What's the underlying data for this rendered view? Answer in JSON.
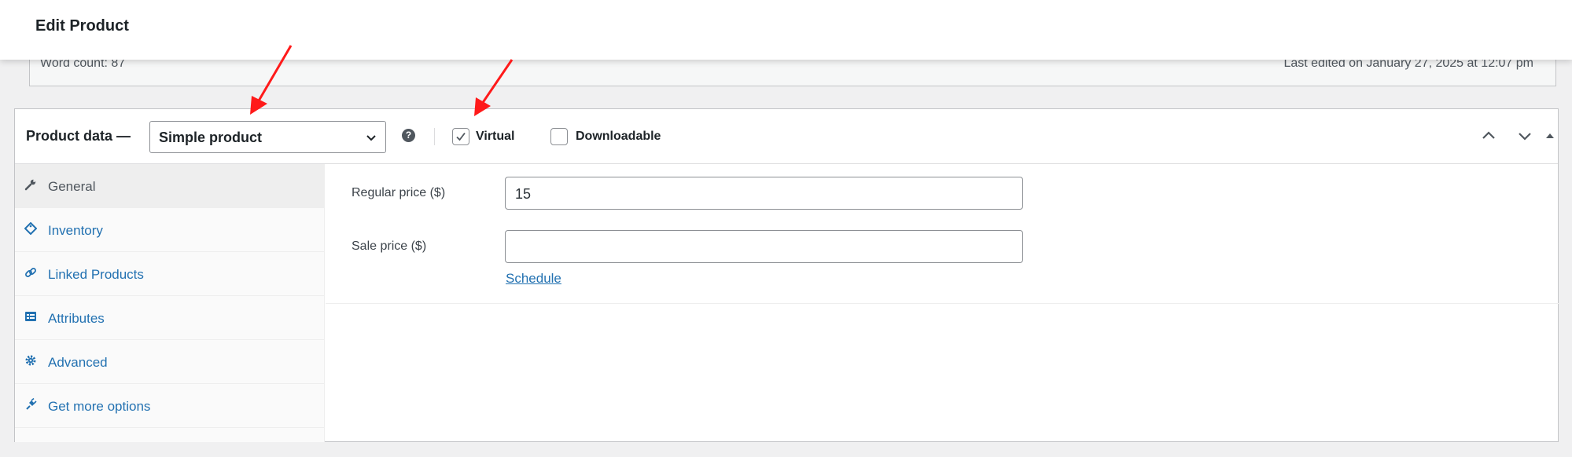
{
  "header": {
    "title": "Edit Product"
  },
  "editor_status": {
    "word_count": "Word count: 87",
    "last_edited": "Last edited on January 27, 2025 at 12:07 pm"
  },
  "product_data": {
    "title": "Product data —",
    "type_select": {
      "selected": "Simple product"
    },
    "help_icon": "?",
    "virtual": {
      "label": "Virtual",
      "checked": true
    },
    "downloadable": {
      "label": "Downloadable",
      "checked": false
    }
  },
  "tabs": [
    {
      "label": "General",
      "icon": "wrench-icon",
      "active": true
    },
    {
      "label": "Inventory",
      "icon": "tag-icon"
    },
    {
      "label": "Linked Products",
      "icon": "link-icon"
    },
    {
      "label": "Attributes",
      "icon": "list-card-icon"
    },
    {
      "label": "Advanced",
      "icon": "gear-icon"
    },
    {
      "label": "Get more options",
      "icon": "plugin-icon"
    }
  ],
  "general": {
    "regular_price_label": "Regular price ($)",
    "regular_price_value": "15",
    "sale_price_label": "Sale price ($)",
    "sale_price_value": "",
    "schedule_link": "Schedule"
  },
  "colors": {
    "link": "#2271b1",
    "arrow": "#ff1a1a"
  }
}
